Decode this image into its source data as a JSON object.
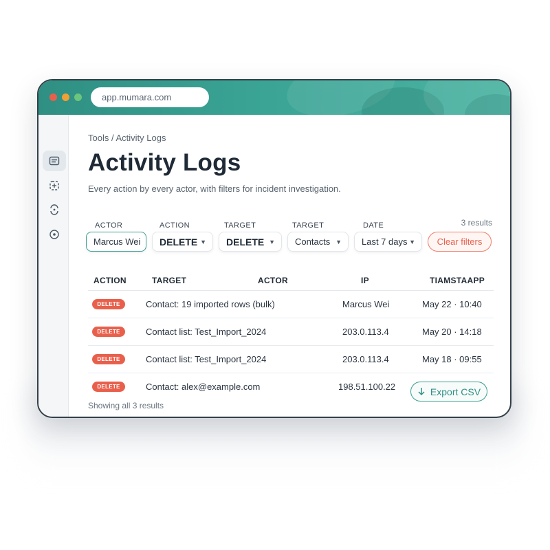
{
  "browser": {
    "url": "app.mumara.com"
  },
  "breadcrumb": "Tools / Activity Logs",
  "page": {
    "title": "Activity Logs",
    "subtitle": "Every action by every actor, with filters for incident investigation."
  },
  "filters": {
    "actor": {
      "label": "ACTOR",
      "value": "Marcus Wei"
    },
    "action": {
      "label": "ACTION",
      "value": "DELETE"
    },
    "target1": {
      "label": "TARGET",
      "value": "DELETE"
    },
    "target2": {
      "label": "TARGET",
      "value": "Contacts"
    },
    "date": {
      "label": "DATE",
      "value": "Last 7 days"
    },
    "results_count": "3 results",
    "clear_label": "Clear filters"
  },
  "table": {
    "headers": {
      "action": "ACTION",
      "target": "TARGET",
      "actor": "ACTOR",
      "ip": "IP",
      "timestamp": "TIAMSTAAPP"
    },
    "rows": [
      {
        "action": "DELETE",
        "target": "Contact: 19 imported rows (bulk)",
        "value": "Marcus Wei",
        "time": "May 22 · 10:40"
      },
      {
        "action": "DELETE",
        "target": "Contact list: Test_Import_2024",
        "value": "203.0.113.4",
        "time": "May 20 · 14:18"
      },
      {
        "action": "DELETE",
        "target": "Contact list: Test_Import_2024",
        "value": "203.0.113.4",
        "time": "May 18 · 09:55"
      },
      {
        "action": "DELETE",
        "target": "Contact: alex@example.com",
        "value": "198.51.100.22",
        "time": ""
      }
    ]
  },
  "footer": {
    "showing": "Showing all 3 results",
    "export_label": "Export CSV"
  },
  "colors": {
    "accent": "#3a9d8f",
    "danger": "#e8604c"
  },
  "icons": {
    "sidebar": [
      "logs-icon",
      "grid-plus-icon",
      "refresh-icon",
      "target-icon"
    ],
    "export": "download-arrow-icon"
  }
}
